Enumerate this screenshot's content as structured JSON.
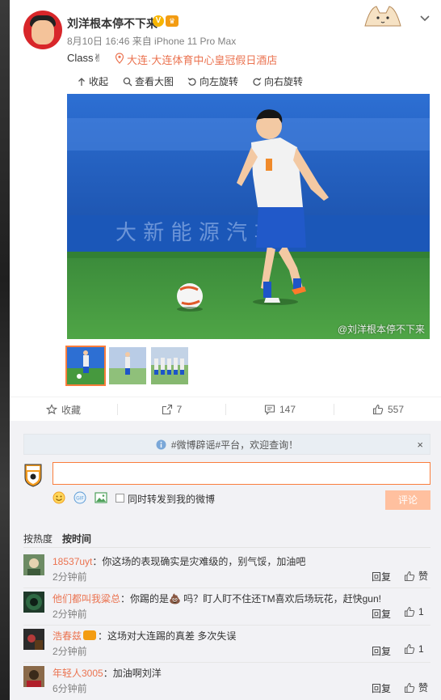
{
  "post": {
    "username": "刘洋根本停不下来",
    "verified_badge": "V",
    "meta": "8月10日 16:46 来自 iPhone 11 Pro Max",
    "content": "Class✌",
    "location": "大连·大连体育中心皇冠假日酒店",
    "toolbar": {
      "collapse": "收起",
      "view_large": "查看大图",
      "rotate_left": "向左旋转",
      "rotate_right": "向右旋转"
    },
    "watermark": "@刘洋根本停不下来"
  },
  "actions": {
    "favorite": "收藏",
    "repost_count": "7",
    "comment_count": "147",
    "like_count": "557"
  },
  "comment_box": {
    "notice": "#微博辟谣#平台，欢迎查询！",
    "notice_close": "×",
    "repost_label": "同时转发到我的微博",
    "submit_label": "评论"
  },
  "sort": {
    "by_heat": "按热度",
    "by_time": "按时间"
  },
  "comments": [
    {
      "user": "18537uyt",
      "text": "：你这场的表现确实是灾难级的，别气馁，加油吧",
      "time": "2分钟前",
      "reply": "回复",
      "like_label": "赞"
    },
    {
      "user": "他们都叫我粱总",
      "text": "：你踢的是💩 吗？盯人盯不住还TM喜欢后场玩花，赶快gun!",
      "time": "2分钟前",
      "reply": "回复",
      "like_label": "1"
    },
    {
      "user": "浩春兹",
      "text": "：这场对大连踢的真差 多次失误",
      "time": "2分钟前",
      "reply": "回复",
      "like_label": "1"
    },
    {
      "user": "年轻人3005",
      "text": "：加油啊刘洋",
      "time": "6分钟前",
      "reply": "回复",
      "like_label": "赞"
    }
  ],
  "colors": {
    "accent": "#eb7350",
    "input_border": "#fa7d3c",
    "submit_disabled": "#ffc09f",
    "comment_bg": "#f2f2f5"
  }
}
